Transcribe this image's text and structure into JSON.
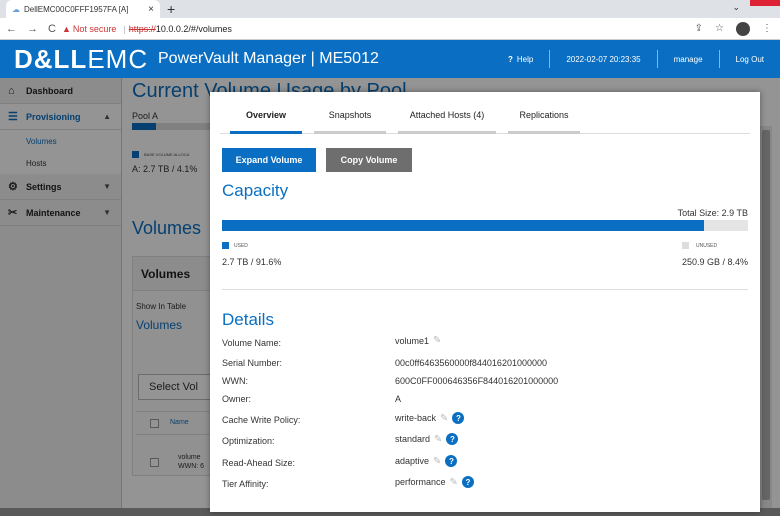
{
  "browser": {
    "tab_title": "DellEMC00C0FFF1957FA [A]",
    "warning": "Not secure",
    "url_scheme": "https://",
    "url_rest": "10.0.0.2/#/volumes"
  },
  "header": {
    "logo_main": "D&LL",
    "logo_sub": "EMC",
    "product": "PowerVault Manager | ME5012",
    "help": "Help",
    "datetime": "2022-02-07 20:23:35",
    "user": "manage",
    "logout": "Log Out"
  },
  "sidebar": {
    "dashboard": "Dashboard",
    "provisioning": "Provisioning",
    "volumes": "Volumes",
    "hosts": "Hosts",
    "settings": "Settings",
    "maintenance": "Maintenance"
  },
  "background": {
    "usage_title": "Current Volume Usage by Pool",
    "pool": "Pool A",
    "pool_fill": 0.041,
    "base_label": "BASE VOLUME ALLOCA",
    "pool_used": "A: 2.7 TB / 4.1%",
    "volumes_title": "Volumes",
    "volumes_box": "Volumes",
    "show_in_table": "Show In Table",
    "volumes_link": "Volumes",
    "select_vol": "Select Vol",
    "col_name": "Name",
    "row_line1": "volume",
    "row_line2": "WWN: 6"
  },
  "modal": {
    "tabs": [
      "Overview",
      "Snapshots",
      "Attached Hosts (4)",
      "Replications"
    ],
    "expand": "Expand Volume",
    "copy": "Copy Volume",
    "capacity_title": "Capacity",
    "total_size": "Total Size: 2.9 TB",
    "used_fraction": 0.916,
    "used_label": "USED",
    "used_value": "2.7 TB / 91.6%",
    "unused_label": "UNUSED",
    "unused_value": "250.9 GB / 8.4%",
    "details_title": "Details",
    "details": [
      {
        "label": "Volume Name:",
        "value": "volume1",
        "edit": true,
        "help": false
      },
      {
        "label": "Serial Number:",
        "value": "00c0ff6463560000f844016201000000",
        "edit": false,
        "help": false
      },
      {
        "label": "WWN:",
        "value": "600C0FF000646356F844016201000000",
        "edit": false,
        "help": false
      },
      {
        "label": "Owner:",
        "value": "A",
        "edit": false,
        "help": false
      },
      {
        "label": "Cache Write Policy:",
        "value": "write-back",
        "edit": true,
        "help": true
      },
      {
        "label": "Optimization:",
        "value": "standard",
        "edit": true,
        "help": true
      },
      {
        "label": "Read-Ahead Size:",
        "value": "adaptive",
        "edit": true,
        "help": true
      },
      {
        "label": "Tier Affinity:",
        "value": "performance",
        "edit": true,
        "help": true
      }
    ]
  }
}
